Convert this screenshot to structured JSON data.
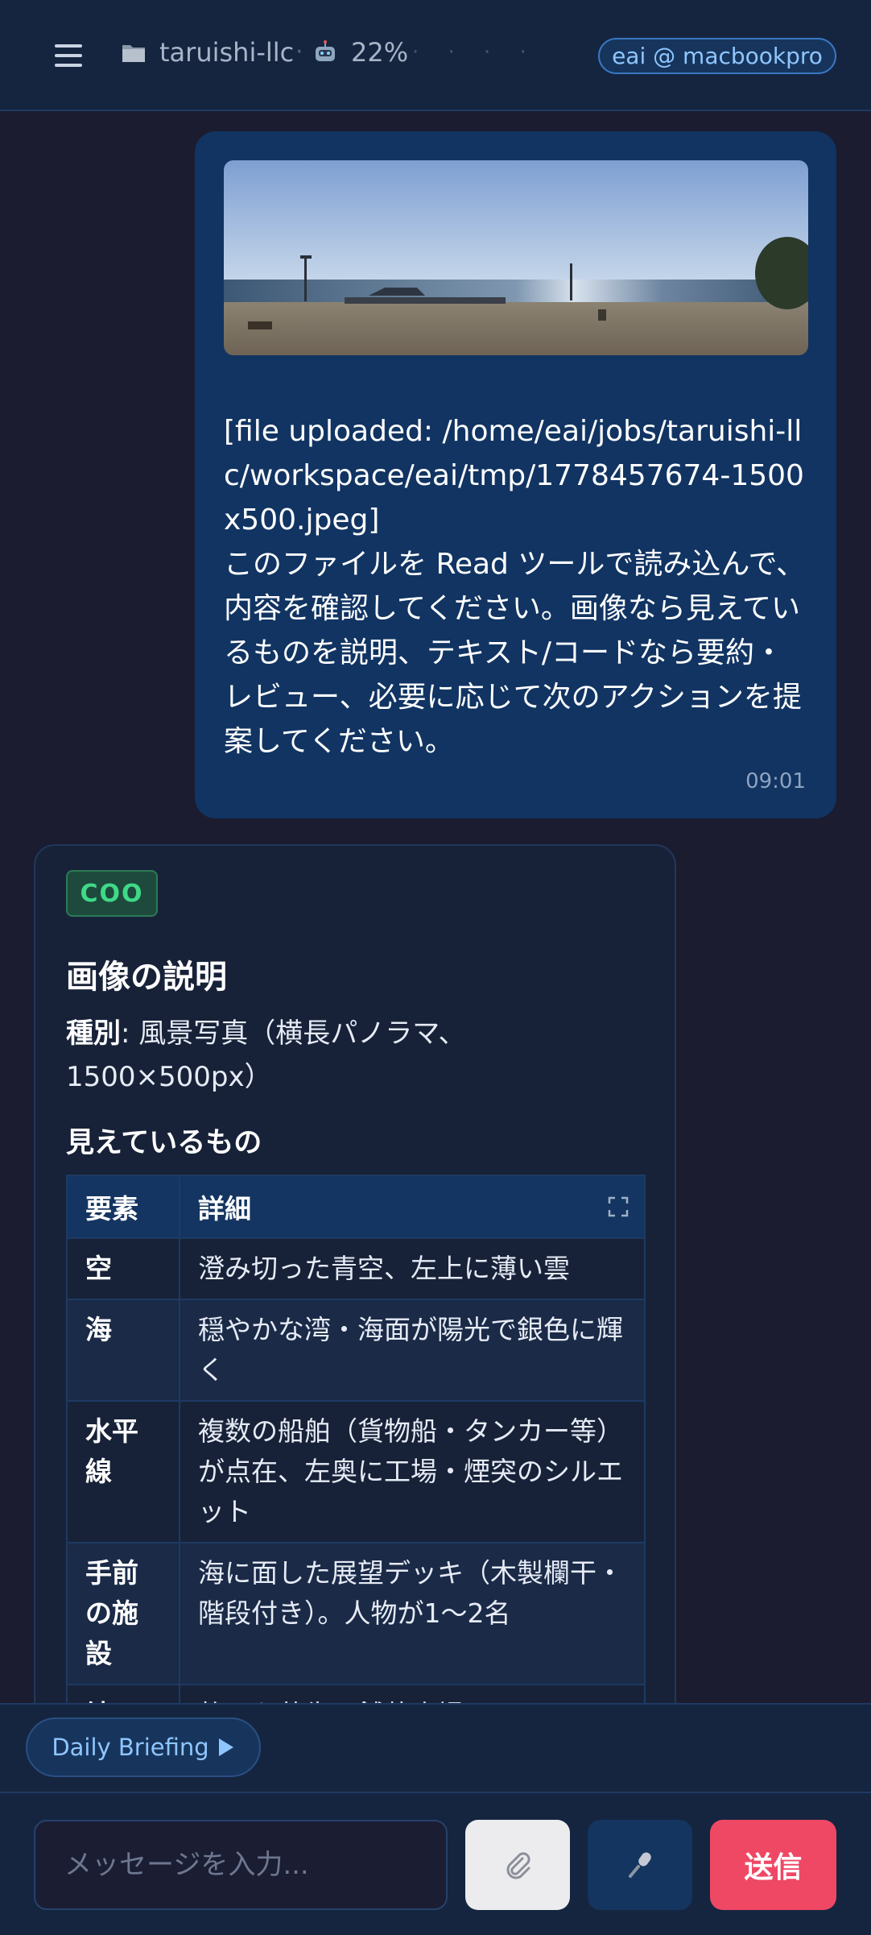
{
  "header": {
    "project": "taruishi-llc",
    "context_pct": "22%",
    "host": "eai @ macbookpro"
  },
  "user_message": {
    "text": "[file uploaded: /home/eai/jobs/taruishi-llc/workspace/eai/tmp/1778457674-1500x500.jpeg]\nこのファイルを Read ツールで読み込んで、内容を確認してください。画像なら見えているものを説明、テキスト/コードなら要約・レビュー、必要に応じて次のアクションを提案してください。",
    "time": "09:01"
  },
  "assistant_message": {
    "role": "COO",
    "heading": "画像の説明",
    "type_label": "種別",
    "type_value": ": 風景写真（横長パノラマ、1500×500px）",
    "subheading": "見えているもの",
    "table": {
      "headers": [
        "要素",
        "詳細"
      ],
      "rows": [
        [
          "空",
          "澄み切った青空、左上に薄い雲"
        ],
        [
          "海",
          "穏やかな湾・海面が陽光で銀色に輝く"
        ],
        [
          "水平線",
          "複数の船舶（貨物船・タンカー等）が点在、左奥に工場・煙突のシルエット"
        ],
        [
          "手前の施設",
          "海に面した展望デッキ（木製欄干・階段付き）。人物が1〜2名"
        ],
        [
          "地面",
          "乾いた芝生、舗装広場、ベンチ"
        ]
      ]
    }
  },
  "quick_actions": {
    "briefing_label": "Daily Briefing"
  },
  "composer": {
    "placeholder": "メッセージを入力...",
    "send_label": "送信"
  }
}
